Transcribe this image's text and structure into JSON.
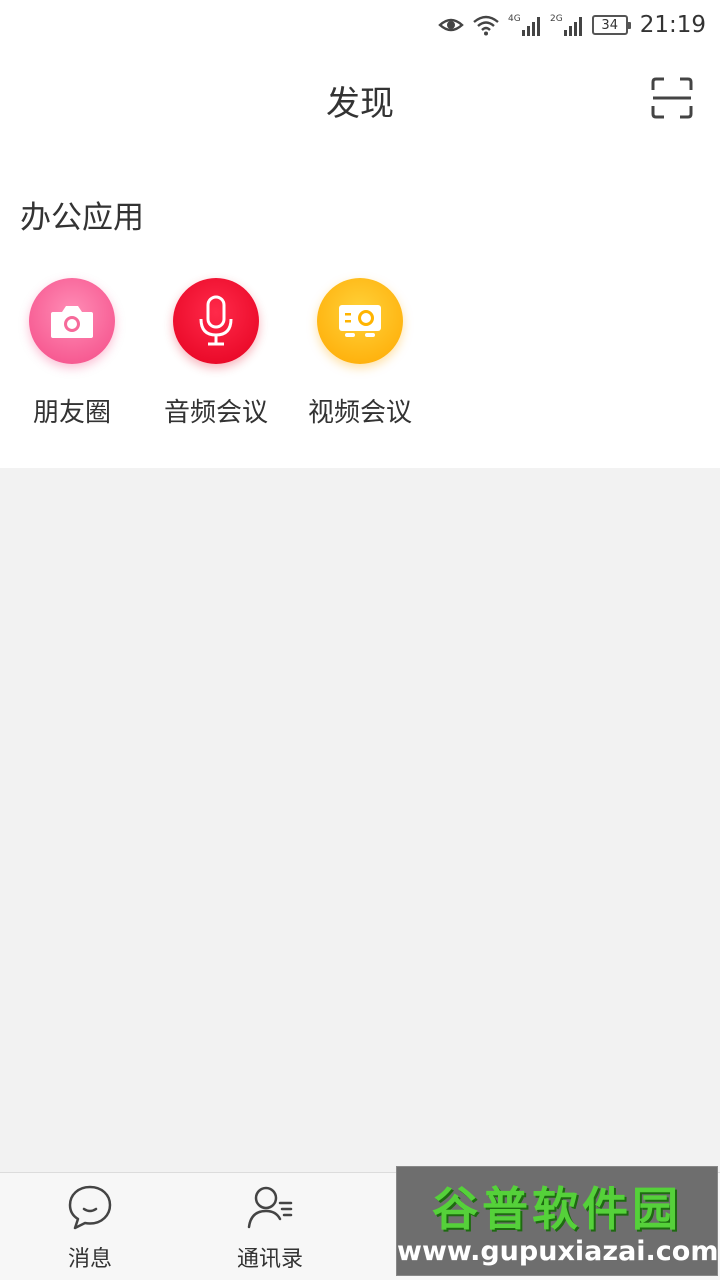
{
  "status_bar": {
    "time": "21:19",
    "battery": "34",
    "net1": "4G",
    "net2": "2G",
    "icons": [
      "eye-icon",
      "wifi-icon",
      "signal-4g-icon",
      "signal-2g-icon",
      "battery-icon"
    ]
  },
  "header": {
    "title": "发现",
    "scan_icon": "scan-icon"
  },
  "section": {
    "title": "办公应用"
  },
  "apps": [
    {
      "label": "朋友圈",
      "icon": "camera-icon",
      "color": "#f44a86"
    },
    {
      "label": "音频会议",
      "icon": "microphone-icon",
      "color": "#e4001f"
    },
    {
      "label": "视频会议",
      "icon": "projector-icon",
      "color": "#ffa800"
    }
  ],
  "bottom_nav": [
    {
      "label": "消息",
      "icon": "chat-bubble-icon"
    },
    {
      "label": "通讯录",
      "icon": "contacts-icon"
    }
  ],
  "watermark": {
    "title": "谷普软件园",
    "url": "www.gupuxiazai.com"
  }
}
